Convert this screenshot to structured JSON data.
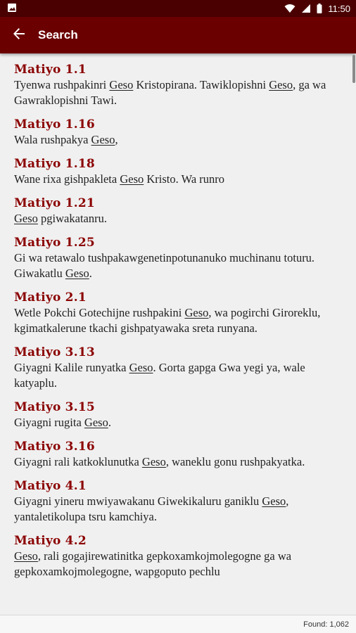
{
  "status_bar": {
    "time": "11:50",
    "icons": [
      "image-icon",
      "wifi-icon",
      "signal-icon",
      "battery-icon"
    ]
  },
  "app_bar": {
    "title": "Search",
    "back_icon": "arrow-left-icon"
  },
  "colors": {
    "status_bar": "#4a0000",
    "app_bar": "#6b0000",
    "reference": "#8b0000",
    "background": "#f0f0f0"
  },
  "results": [
    {
      "ref": "Matiyo 1.1",
      "parts": [
        "Tyenwa rushpakinri ",
        "Geso",
        " Kristopirana. Tawiklopishni ",
        "Geso",
        ", ga wa Gawraklopishni Tawi."
      ]
    },
    {
      "ref": "Matiyo 1.16",
      "parts": [
        "Wala rushpakya ",
        "Geso",
        ","
      ]
    },
    {
      "ref": "Matiyo 1.18",
      "parts": [
        "Wane rixa gishpakleta ",
        "Geso",
        " Kristo. Wa runro"
      ]
    },
    {
      "ref": "Matiyo 1.21",
      "parts": [
        "",
        "Geso",
        " pgiwakatanru."
      ]
    },
    {
      "ref": "Matiyo 1.25",
      "parts": [
        "Gi wa retawalo tushpakawgenetinpotunanuko muchinanu toturu. Giwakatlu ",
        "Geso",
        "."
      ]
    },
    {
      "ref": "Matiyo 2.1",
      "parts": [
        "Wetle Pokchi Gotechijne rushpakini ",
        "Geso",
        ", wa pogirchi Giroreklu, kgimatkalerune tkachi gishpatyawaka sreta runyana."
      ]
    },
    {
      "ref": "Matiyo 3.13",
      "parts": [
        "Giyagni Kalile runyatka ",
        "Geso",
        ". Gorta gapga Gwa yegi ya, wale katyaplu."
      ]
    },
    {
      "ref": "Matiyo 3.15",
      "parts": [
        "Giyagni rugita ",
        "Geso",
        "."
      ]
    },
    {
      "ref": "Matiyo 3.16",
      "parts": [
        "Giyagni rali katkoklunutka ",
        "Geso",
        ", waneklu gonu rushpakyatka."
      ]
    },
    {
      "ref": "Matiyo 4.1",
      "parts": [
        "Giyagni yineru mwiyawakanu Giwekikaluru ganiklu ",
        "Geso",
        ", yantaletikolupa tsru kamchiya."
      ]
    },
    {
      "ref": "Matiyo 4.2",
      "parts": [
        "",
        "Geso",
        ", rali gogajirewatinitka gepkoxamkojmolegogne ga wa gepkoxamkojmolegogne, wapgoputo pechlu"
      ]
    }
  ],
  "footer": {
    "found_text": "Found: 1,062"
  }
}
